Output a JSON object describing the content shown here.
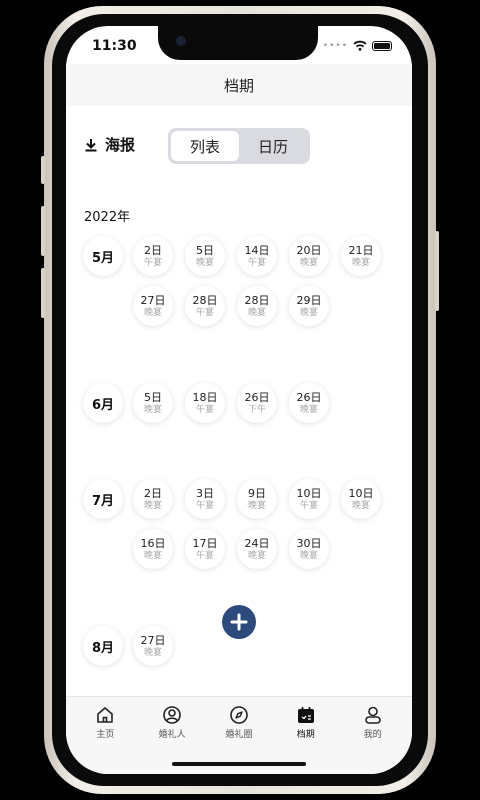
{
  "status_bar": {
    "time": "11:30",
    "signal_dots": "••••"
  },
  "header": {
    "title": "档期"
  },
  "toolbar": {
    "poster_label": "海报",
    "segments": [
      {
        "label": "列表",
        "active": true
      },
      {
        "label": "日历",
        "active": false
      }
    ]
  },
  "schedule": {
    "year": "2022年",
    "months": [
      {
        "label": "5月",
        "dates": [
          {
            "day": "2日",
            "slot": "午宴"
          },
          {
            "day": "5日",
            "slot": "晚宴"
          },
          {
            "day": "14日",
            "slot": "午宴"
          },
          {
            "day": "20日",
            "slot": "晚宴"
          },
          {
            "day": "21日",
            "slot": "晚宴"
          },
          {
            "day": "27日",
            "slot": "晚宴"
          },
          {
            "day": "28日",
            "slot": "午宴"
          },
          {
            "day": "28日",
            "slot": "晚宴"
          },
          {
            "day": "29日",
            "slot": "晚宴"
          }
        ]
      },
      {
        "label": "6月",
        "dates": [
          {
            "day": "5日",
            "slot": "晚宴"
          },
          {
            "day": "18日",
            "slot": "午宴"
          },
          {
            "day": "26日",
            "slot": "下午"
          },
          {
            "day": "26日",
            "slot": "晚宴"
          }
        ]
      },
      {
        "label": "7月",
        "dates": [
          {
            "day": "2日",
            "slot": "晚宴"
          },
          {
            "day": "3日",
            "slot": "午宴"
          },
          {
            "day": "9日",
            "slot": "晚宴"
          },
          {
            "day": "10日",
            "slot": "午宴"
          },
          {
            "day": "10日",
            "slot": "晚宴"
          },
          {
            "day": "16日",
            "slot": "晚宴"
          },
          {
            "day": "17日",
            "slot": "午宴"
          },
          {
            "day": "24日",
            "slot": "晚宴"
          },
          {
            "day": "30日",
            "slot": "晚宴"
          }
        ]
      },
      {
        "label": "8月",
        "dates": [
          {
            "day": "27日",
            "slot": "晚宴"
          }
        ]
      }
    ]
  },
  "tabbar": {
    "items": [
      {
        "label": "主页",
        "icon": "home-icon",
        "active": false
      },
      {
        "label": "婚礼人",
        "icon": "person-circle-icon",
        "active": false
      },
      {
        "label": "婚礼圈",
        "icon": "compass-icon",
        "active": false
      },
      {
        "label": "档期",
        "icon": "calendar-icon",
        "active": true
      },
      {
        "label": "我的",
        "icon": "profile-icon",
        "active": false
      }
    ]
  },
  "colors": {
    "accent": "#2d4a7c",
    "header_bg": "#f7f7f7"
  }
}
